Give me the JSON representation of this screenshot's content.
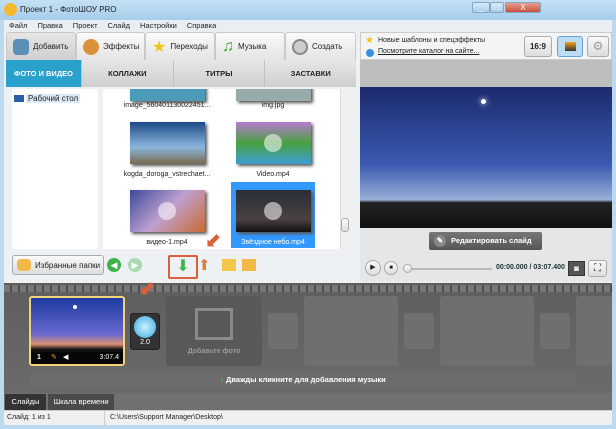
{
  "window": {
    "title": "Проект 1 - ФотоШОУ PRO",
    "min": "_",
    "max": "□",
    "close": "X"
  },
  "menu": [
    "Файл",
    "Правка",
    "Проект",
    "Слайд",
    "Настройки",
    "Справка"
  ],
  "tabs": [
    {
      "label": "Добавить",
      "icon": "camera-icon",
      "color": "#5a8fb8"
    },
    {
      "label": "Эффекты",
      "icon": "palette-icon",
      "color": "#d9913a"
    },
    {
      "label": "Переходы",
      "icon": "star-icon",
      "color": "#f2c21c"
    },
    {
      "label": "Музыка",
      "icon": "music-note-icon",
      "color": "#3dab2e"
    },
    {
      "label": "Создать",
      "icon": "film-reel-icon",
      "color": "#999999"
    }
  ],
  "subtabs": [
    "ФОТО И ВИДЕО",
    "КОЛЛАЖИ",
    "ТИТРЫ",
    "ЗАСТАВКИ"
  ],
  "tree": {
    "item": "Рабочий стол"
  },
  "files": [
    "image_560401130022451...",
    "img.jpg",
    "kogda_doroga_vstrechaet...",
    "Video.mp4",
    "видео-1.mp4",
    "Звёздное небо.mp4"
  ],
  "toolbar": {
    "favorites": "Избранные папки"
  },
  "info": {
    "new": "Новые шаблоны и спецэффекты",
    "catalog": "Посмотрите каталог на сайте...",
    "ratio": "16:9"
  },
  "preview": {
    "edit": "Редактировать слайд",
    "time": "00:00.000 / 03:07.400",
    "progress": 0
  },
  "timeline": {
    "slide_num": "1",
    "slide_dur": "3:07.4",
    "trans_dur": "2.0",
    "add_photo": "Добавьте фото",
    "music": "Дважды кликните для добавления музыки"
  },
  "bottom_tabs": [
    "Слайды",
    "Шкала времени"
  ],
  "status": {
    "slide": "Слайд: 1 из 1",
    "path": "C:\\Users\\Support Manager\\Desktop\\"
  },
  "accent": "#2aa0cc"
}
